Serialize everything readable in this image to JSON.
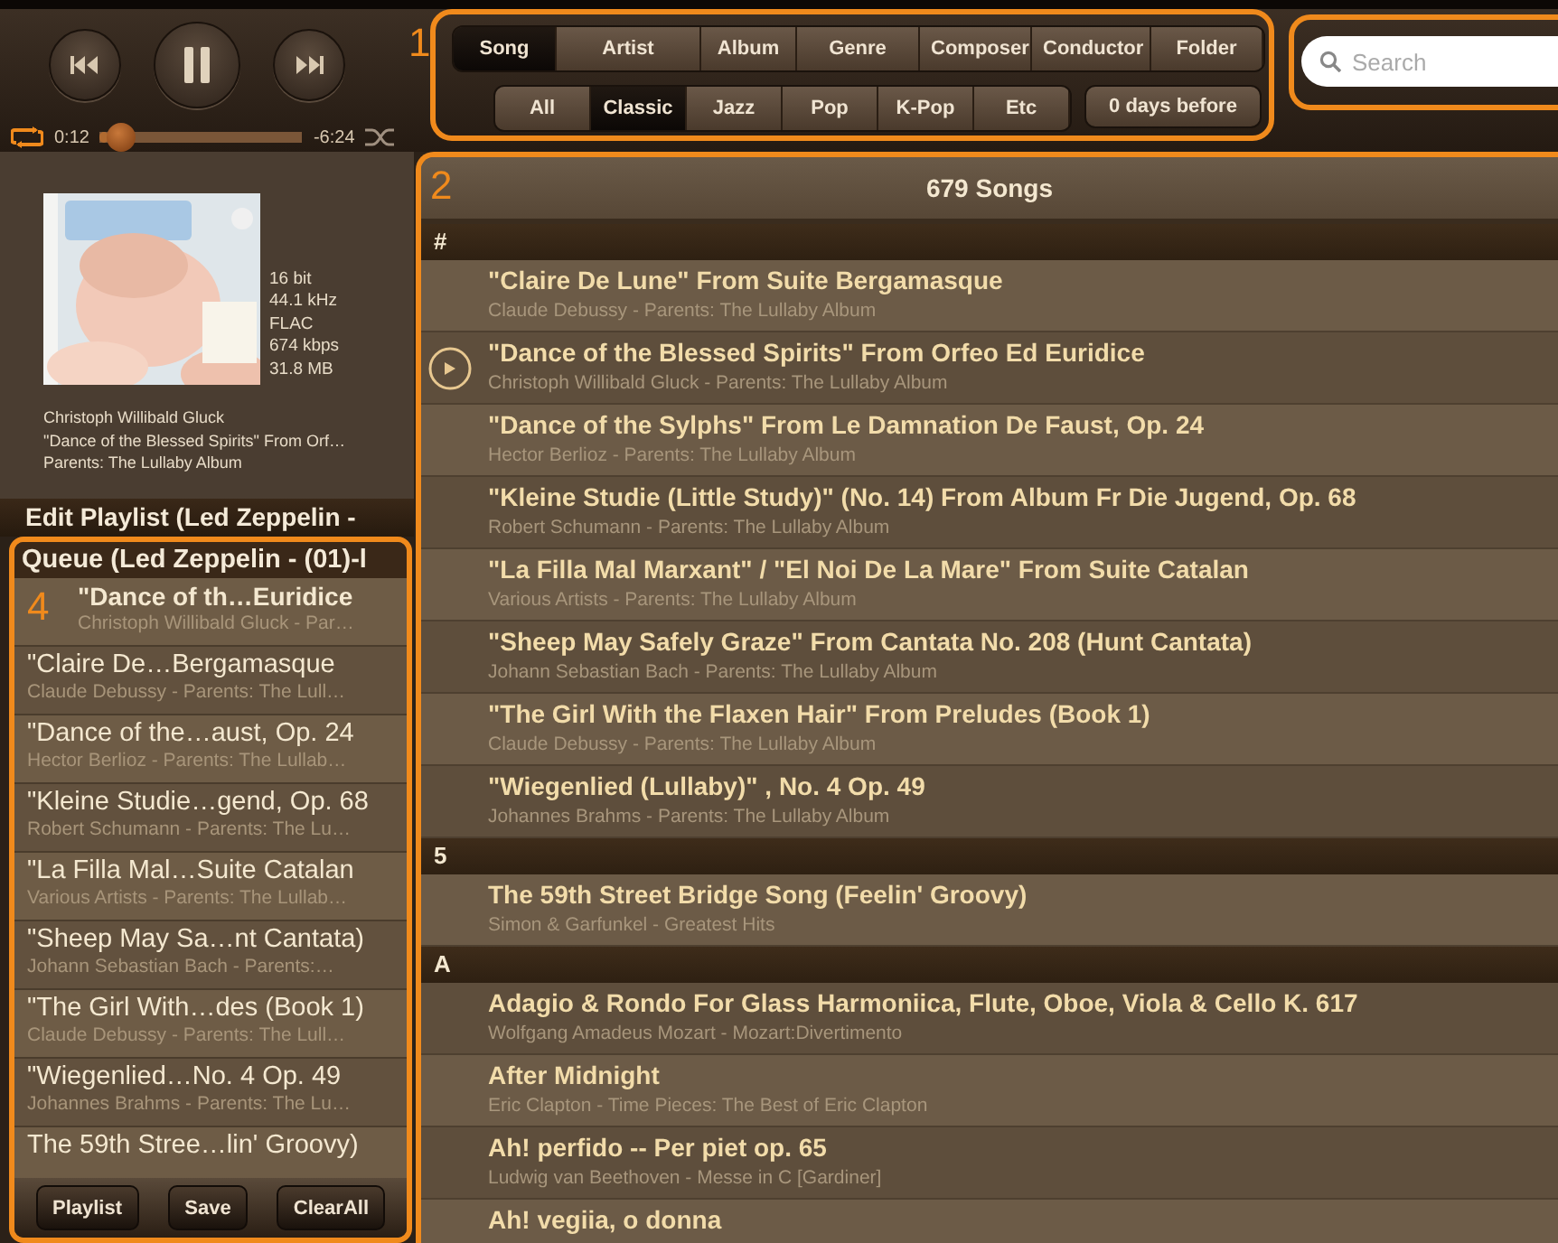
{
  "player": {
    "playing": true,
    "elapsed": "0:12",
    "remaining": "-6:24",
    "level": 0.04
  },
  "filters": {
    "callout": "1",
    "categories": [
      {
        "label": "Song",
        "selected": true
      },
      {
        "label": "Artist",
        "selected": false
      },
      {
        "label": "Album",
        "selected": false
      },
      {
        "label": "Genre",
        "selected": false
      },
      {
        "label": "Composer",
        "selected": false
      },
      {
        "label": "Conductor",
        "selected": false
      },
      {
        "label": "Folder",
        "selected": false
      }
    ],
    "genres": [
      {
        "label": "All",
        "selected": false
      },
      {
        "label": "Classic",
        "selected": true
      },
      {
        "label": "Jazz",
        "selected": false
      },
      {
        "label": "Pop",
        "selected": false
      },
      {
        "label": "K-Pop",
        "selected": false
      },
      {
        "label": "Etc",
        "selected": false
      }
    ],
    "date_filter": "0 days before"
  },
  "search": {
    "placeholder": "Search"
  },
  "now_playing": {
    "cover": {
      "kind": "picture"
    },
    "format": [
      "16 bit",
      "44.1 kHz",
      "FLAC",
      "674 kbps",
      "31.8 MB"
    ],
    "artist": "Christoph Willibald Gluck",
    "title": "\"Dance of the Blessed Spirits\" From Orf…",
    "album": "Parents: The Lullaby Album"
  },
  "playlist_bar": "Edit Playlist (Led Zeppelin -",
  "queue": {
    "title": "Queue (Led Zeppelin - (01)-l",
    "callout": "4",
    "items": [
      {
        "title": "\"Dance of th…Euridice",
        "subtitle": "Christoph Willibald Gluck - Par…",
        "current": true
      },
      {
        "title": "\"Claire De…Bergamasque",
        "subtitle": "Claude Debussy - Parents: The Lull…",
        "current": false
      },
      {
        "title": "\"Dance of the…aust, Op. 24",
        "subtitle": "Hector Berlioz - Parents: The Lullab…",
        "current": false
      },
      {
        "title": "\"Kleine Studie…gend, Op. 68",
        "subtitle": "Robert Schumann - Parents: The Lu…",
        "current": false
      },
      {
        "title": "\"La Filla Mal…Suite Catalan",
        "subtitle": "Various Artists - Parents: The Lullab…",
        "current": false
      },
      {
        "title": "\"Sheep May Sa…nt Cantata)",
        "subtitle": "Johann Sebastian Bach - Parents:…",
        "current": false
      },
      {
        "title": "\"The Girl With…des (Book 1)",
        "subtitle": "Claude Debussy - Parents: The Lull…",
        "current": false
      },
      {
        "title": "\"Wiegenlied…No. 4 Op. 49",
        "subtitle": "Johannes Brahms - Parents: The Lu…",
        "current": false
      },
      {
        "title": "The 59th Stree…lin' Groovy)",
        "current": false
      }
    ],
    "buttons": [
      "Playlist",
      "Save",
      "ClearAll"
    ]
  },
  "song_list": {
    "callout": "2",
    "title": "679 Songs",
    "sections": [
      {
        "letter": "#",
        "songs": [
          {
            "title": "\"Claire De Lune\" From Suite Bergamasque",
            "subtitle": "Claude Debussy - Parents: The Lullaby Album",
            "playing": false
          },
          {
            "title": "\"Dance of the Blessed Spirits\" From Orfeo Ed Euridice",
            "subtitle": "Christoph Willibald Gluck - Parents: The Lullaby Album",
            "playing": true
          },
          {
            "title": "\"Dance of the Sylphs\" From Le Damnation De Faust, Op. 24",
            "subtitle": "Hector Berlioz - Parents: The Lullaby Album",
            "playing": false
          },
          {
            "title": "\"Kleine Studie (Little Study)\" (No. 14) From Album Fr Die Jugend, Op. 68",
            "subtitle": "Robert Schumann - Parents: The Lullaby Album",
            "playing": false
          },
          {
            "title": "\"La Filla Mal Marxant\" / \"El Noi De La Mare\" From Suite Catalan",
            "subtitle": "Various Artists - Parents: The Lullaby Album",
            "playing": false
          },
          {
            "title": "\"Sheep May Safely Graze\" From Cantata No. 208 (Hunt Cantata)",
            "subtitle": "Johann Sebastian Bach - Parents: The Lullaby Album",
            "playing": false
          },
          {
            "title": "\"The Girl With the Flaxen Hair\" From Preludes (Book 1)",
            "subtitle": "Claude Debussy - Parents: The Lullaby Album",
            "playing": false
          },
          {
            "title": "\"Wiegenlied (Lullaby)\" , No. 4 Op. 49",
            "subtitle": "Johannes Brahms - Parents: The Lullaby Album",
            "playing": false
          }
        ]
      },
      {
        "letter": "5",
        "songs": [
          {
            "title": "The 59th Street Bridge Song (Feelin' Groovy)",
            "subtitle": "Simon & Garfunkel - Greatest Hits",
            "playing": false
          }
        ]
      },
      {
        "letter": "A",
        "songs": [
          {
            "title": "Adagio & Rondo For Glass Harmoniica, Flute, Oboe, Viola & Cello K. 617",
            "subtitle": "Wolfgang Amadeus Mozart - Mozart:Divertimento",
            "playing": false
          },
          {
            "title": "After Midnight",
            "subtitle": "Eric Clapton - Time Pieces: The Best of Eric Clapton",
            "playing": false
          },
          {
            "title": "Ah! perfido -- Per piet op. 65",
            "subtitle": "Ludwig van Beethoven - Messe in C [Gardiner]",
            "playing": false
          },
          {
            "title": "Ah! vegiia, o donna",
            "playing": false
          }
        ]
      }
    ]
  }
}
